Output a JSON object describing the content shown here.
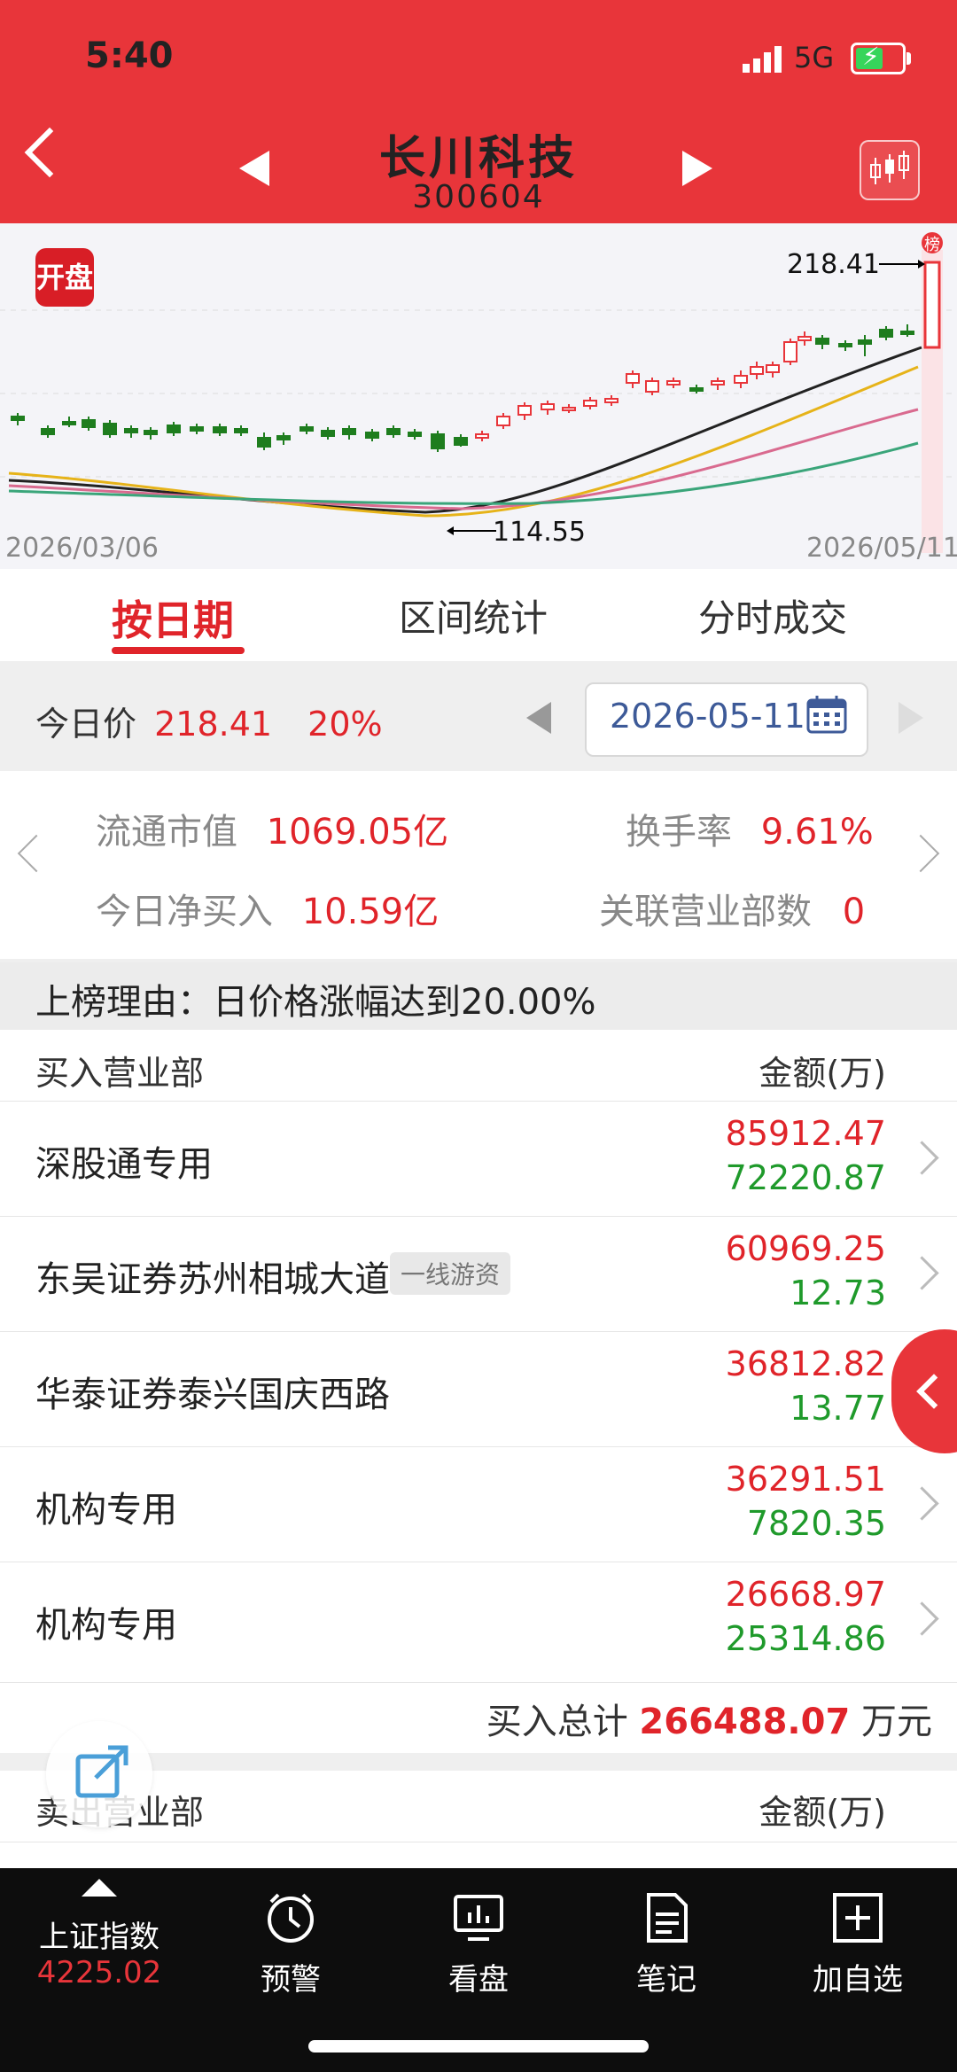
{
  "status_bar": {
    "time": "5:40",
    "network": "5G"
  },
  "header": {
    "stock_name": "长川科技",
    "stock_code": "300604"
  },
  "chart": {
    "badge": "开盘",
    "high_label": "218.41",
    "low_label": "114.55",
    "start_date": "2026/03/06",
    "end_date": "2026/05/11",
    "marker": "榜",
    "colors": {
      "up": "#e8353a",
      "down": "#1e7d1e",
      "ma5": "#222222",
      "ma10": "#e6b319",
      "ma20": "#d96a8f",
      "ma60": "#3aa57a"
    }
  },
  "tabs": [
    "按日期",
    "区间统计",
    "分时成交"
  ],
  "date_bar": {
    "today_label": "今日价",
    "price": "218.41",
    "change": "20%",
    "date": "2026-05-11"
  },
  "stats": {
    "market_cap_label": "流通市值",
    "market_cap": "1069.05亿",
    "turnover_label": "换手率",
    "turnover": "9.61%",
    "net_buy_label": "今日净买入",
    "net_buy": "10.59亿",
    "branches_label": "关联营业部数",
    "branches": "0"
  },
  "reason": "上榜理由：日价格涨幅达到20.00%",
  "buy_table": {
    "header_left": "买入营业部",
    "header_right": "金额(万)",
    "rows": [
      {
        "name": "深股通专用",
        "tag": "",
        "buy": "85912.47",
        "sell": "72220.87"
      },
      {
        "name": "东吴证券苏州相城大道",
        "tag": "一线游资",
        "buy": "60969.25",
        "sell": "12.73"
      },
      {
        "name": "华泰证券泰兴国庆西路",
        "tag": "",
        "buy": "36812.82",
        "sell": "13.77"
      },
      {
        "name": "机构专用",
        "tag": "",
        "buy": "36291.51",
        "sell": "7820.35"
      },
      {
        "name": "机构专用",
        "tag": "",
        "buy": "26668.97",
        "sell": "25314.86"
      }
    ],
    "total_label": "买入总计",
    "total_value": "266488.07",
    "total_unit": "万元"
  },
  "sell_table": {
    "header_left": "卖出营业部",
    "header_right": "金额(万)"
  },
  "bottom_nav": {
    "index_name": "上证指数",
    "index_value": "4225.02",
    "items": [
      "预警",
      "看盘",
      "笔记",
      "加自选"
    ]
  }
}
